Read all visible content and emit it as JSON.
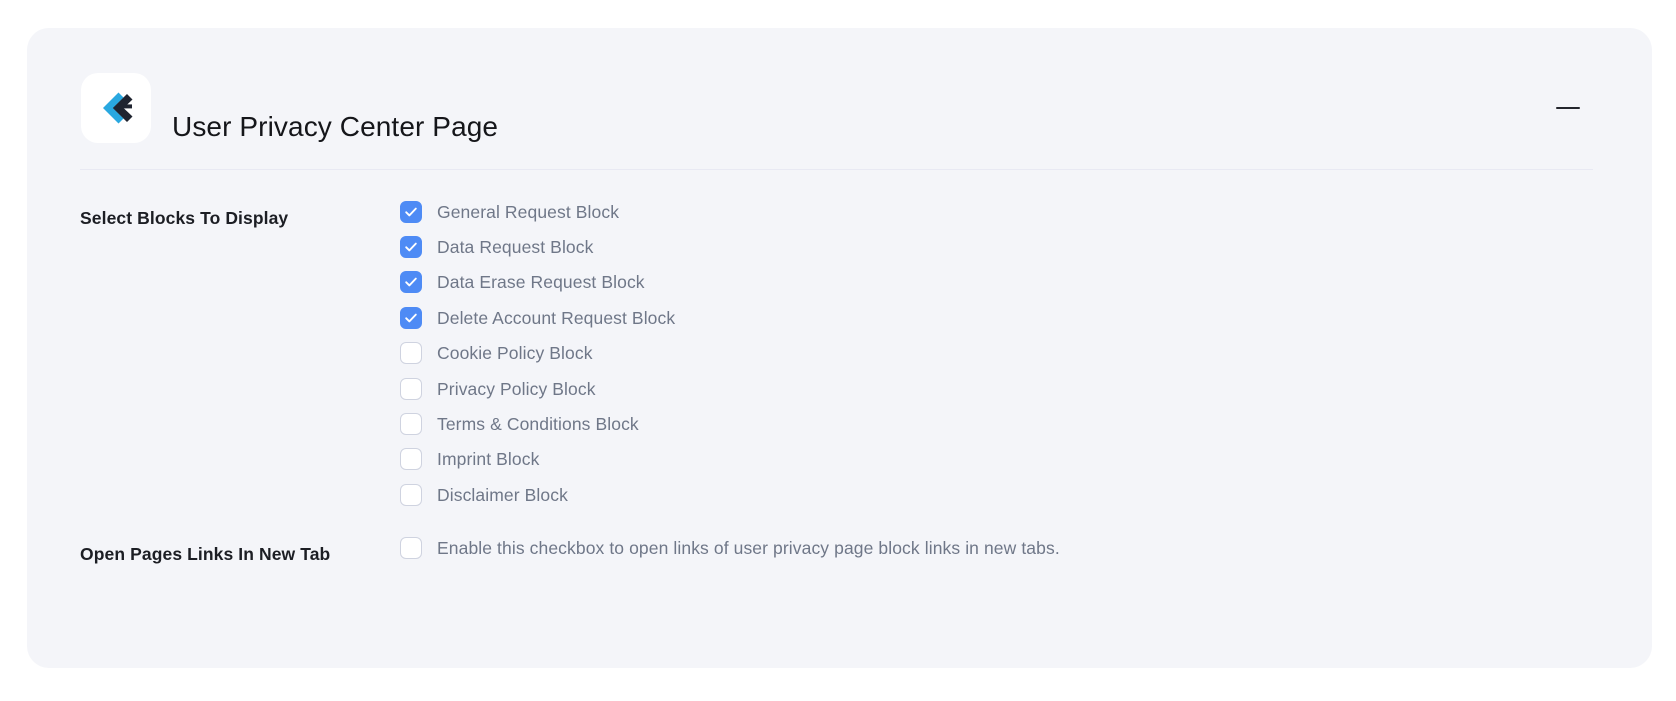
{
  "card": {
    "title": "User Privacy Center Page",
    "logo_icon": "chevron-e-logo-icon",
    "collapse_icon": "minus-icon",
    "accent_color": "#4e8bf5",
    "card_background": "#f4f5f9",
    "title_color": "#15161a",
    "label_color": "#1c1e24",
    "option_text_color": "#6f7788",
    "checkbox_border_color": "#cfd3e0",
    "divider_color": "#e8e9f3"
  },
  "blocks_section": {
    "label": "Select Blocks To Display",
    "options": [
      {
        "label": "General Request Block",
        "checked": true
      },
      {
        "label": "Data Request Block",
        "checked": true
      },
      {
        "label": "Data Erase Request Block",
        "checked": true
      },
      {
        "label": "Delete Account Request Block",
        "checked": true
      },
      {
        "label": "Cookie Policy Block",
        "checked": false
      },
      {
        "label": "Privacy Policy Block",
        "checked": false
      },
      {
        "label": "Terms & Conditions Block",
        "checked": false
      },
      {
        "label": "Imprint Block",
        "checked": false
      },
      {
        "label": "Disclaimer Block",
        "checked": false
      }
    ]
  },
  "new_tab_section": {
    "label": "Open Pages Links In New Tab",
    "option": {
      "label": "Enable this checkbox to open links of user privacy page block links in new tabs.",
      "checked": false
    }
  }
}
